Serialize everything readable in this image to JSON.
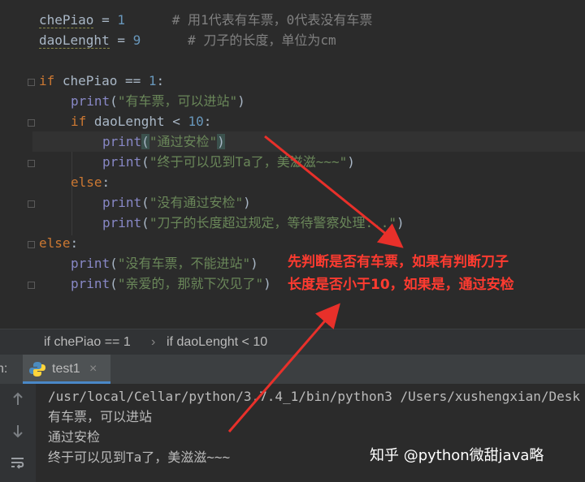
{
  "editor": {
    "line1": {
      "var": "chePiao",
      "eq": " = ",
      "val": "1",
      "comment": "# 用1代表有车票，0代表没有车票"
    },
    "line2": {
      "var": "daoLenght",
      "eq": " = ",
      "val": "9",
      "comment": "# 刀子的长度，单位为cm"
    },
    "line4": {
      "kw": "if",
      "expr": " chePiao == ",
      "num": "1",
      "colon": ":"
    },
    "line5": {
      "fn": "print",
      "open": "(",
      "str": "\"有车票，可以进站\"",
      "close": ")"
    },
    "line6": {
      "kw": "if",
      "expr": " daoLenght < ",
      "num": "10",
      "colon": ":"
    },
    "line7": {
      "fn": "print",
      "open": "(",
      "str": "\"通过安检\"",
      "close": ")"
    },
    "line8": {
      "fn": "print",
      "open": "(",
      "str": "\"终于可以见到Ta了，美滋滋~~~\"",
      "close": ")"
    },
    "line9": {
      "kw": "else",
      "colon": ":"
    },
    "line10": {
      "fn": "print",
      "open": "(",
      "str": "\"没有通过安检\"",
      "close": ")"
    },
    "line11": {
      "fn": "print",
      "open": "(",
      "str": "\"刀子的长度超过规定，等待警察处理...\"",
      "close": ")"
    },
    "line12": {
      "kw": "else",
      "colon": ":"
    },
    "line13": {
      "fn": "print",
      "open": "(",
      "str": "\"没有车票，不能进站\"",
      "close": ")"
    },
    "line14": {
      "fn": "print",
      "open": "(",
      "str": "\"亲爱的，那就下次见了\"",
      "close": ")"
    }
  },
  "annotation": {
    "line1": "先判断是否有车票，如果有判断刀子",
    "line2": "长度是否小于10，如果是，通过安检"
  },
  "breadcrumb": {
    "item1": "if chePiao == 1",
    "sep": "›",
    "item2": "if daoLenght < 10"
  },
  "run": {
    "prefix": "n:",
    "tab_label": "test1",
    "close": "×"
  },
  "console": {
    "cmd": "/usr/local/Cellar/python/3.7.4_1/bin/python3 /Users/xushengxian/Desk",
    "out1": "有车票，可以进站",
    "out2": "通过安检",
    "out3": "终于可以见到Ta了，美滋滋~~~"
  },
  "watermark": "知乎 @python微甜java略",
  "colors": {
    "background": "#2b2b2b",
    "keyword": "#cc7832",
    "string": "#6a8759",
    "number": "#6897bb",
    "comment": "#808080",
    "annotation": "#ff3b30"
  }
}
